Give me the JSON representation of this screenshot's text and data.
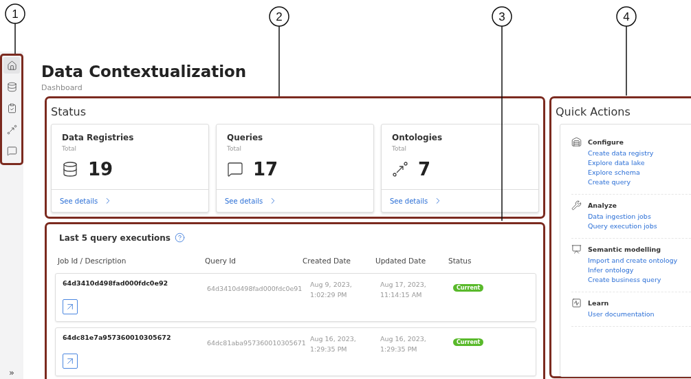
{
  "callouts": [
    "1",
    "2",
    "3",
    "4"
  ],
  "sidebar": {
    "items": [
      {
        "kind": "home",
        "selected": true
      },
      {
        "kind": "database",
        "selected": false
      },
      {
        "kind": "clipboard",
        "selected": false
      },
      {
        "kind": "ontology",
        "selected": false
      },
      {
        "kind": "chat",
        "selected": false
      }
    ],
    "expand": "»"
  },
  "header": {
    "title": "Data Contextualization",
    "subtitle": "Dashboard"
  },
  "status": {
    "title": "Status",
    "cards": [
      {
        "title": "Data Registries",
        "caption": "Total",
        "kind": "database",
        "count": "19",
        "link": "See details"
      },
      {
        "title": "Queries",
        "caption": "Total",
        "kind": "chat",
        "count": "17",
        "link": "See details"
      },
      {
        "title": "Ontologies",
        "caption": "Total",
        "kind": "ontology",
        "count": "7",
        "link": "See details"
      }
    ]
  },
  "executions": {
    "title": "Last 5 query executions",
    "columns": [
      "Job Id / Description",
      "Query Id",
      "Created Date",
      "Updated Date",
      "Status"
    ],
    "rows": [
      {
        "job_id": "64d3410d498fad000fdc0e92",
        "query_id": "64d3410d498fad000fdc0e91",
        "created": [
          "Aug 9, 2023,",
          "1:02:29 PM"
        ],
        "updated": [
          "Aug 17, 2023,",
          "11:14:15 AM"
        ],
        "status": "Current"
      },
      {
        "job_id": "64dc81e7a957360010305672",
        "query_id": "64dc81aba957360010305671",
        "created": [
          "Aug 16, 2023,",
          "1:29:35 PM"
        ],
        "updated": [
          "Aug 16, 2023,",
          "1:29:35 PM"
        ],
        "status": "Current"
      }
    ]
  },
  "quick_actions": {
    "title": "Quick Actions",
    "sections": [
      {
        "kind": "configure",
        "title": "Configure",
        "links": [
          "Create data registry",
          "Explore data lake",
          "Explore schema",
          "Create query"
        ]
      },
      {
        "kind": "analyze",
        "title": "Analyze",
        "links": [
          "Data ingestion jobs",
          "Query execution jobs"
        ]
      },
      {
        "kind": "semantic",
        "title": "Semantic modelling",
        "links": [
          "Import and create ontology",
          "Infer ontology",
          "Create business query"
        ]
      },
      {
        "kind": "learn",
        "title": "Learn",
        "links": [
          "User documentation"
        ]
      }
    ]
  }
}
